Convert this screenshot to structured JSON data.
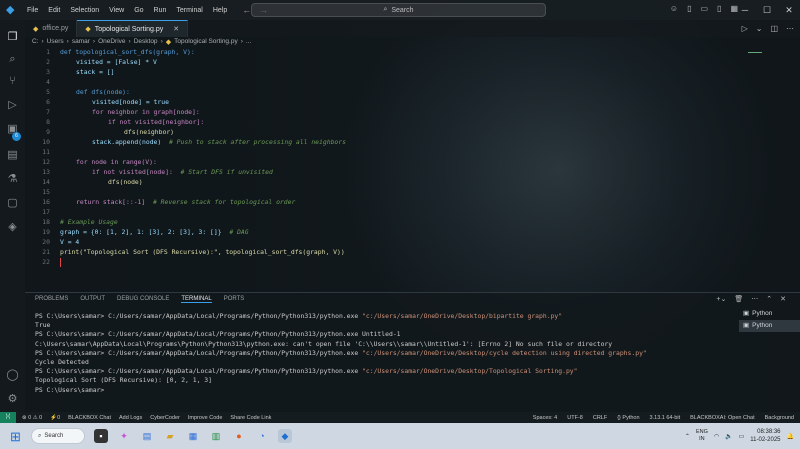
{
  "menu": [
    "File",
    "Edit",
    "Selection",
    "View",
    "Go",
    "Run",
    "Terminal",
    "Help"
  ],
  "search": {
    "label": "Search"
  },
  "tabs": [
    {
      "label": "office.py",
      "active": false
    },
    {
      "label": "Topological Sorting.py",
      "active": true
    }
  ],
  "breadcrumb": [
    "C:",
    "Users",
    "samar",
    "OneDrive",
    "Desktop",
    "Topological Sorting.py",
    "..."
  ],
  "code_lines": [
    {
      "n": "1"
    },
    {
      "n": "2"
    },
    {
      "n": "3"
    },
    {
      "n": "4"
    },
    {
      "n": "5"
    },
    {
      "n": "6"
    },
    {
      "n": "7"
    },
    {
      "n": "8"
    },
    {
      "n": "9"
    },
    {
      "n": "10"
    },
    {
      "n": "11"
    },
    {
      "n": "12"
    },
    {
      "n": "13"
    },
    {
      "n": "14"
    },
    {
      "n": "15"
    },
    {
      "n": "16"
    },
    {
      "n": "17"
    },
    {
      "n": "18"
    },
    {
      "n": "19"
    },
    {
      "n": "20"
    },
    {
      "n": "21"
    },
    {
      "n": "22"
    }
  ],
  "code": {
    "l1": "def topological_sort_dfs(graph, V):",
    "l2": "visited = [False] * V",
    "l3": "stack = []",
    "l5": "def dfs(node):",
    "l6": "visited[node] = true",
    "l7": "for neighbor in graph[node]:",
    "l8": "if not visited[neighbor]:",
    "l9": "dfs(neighbor)",
    "l10a": "stack.append(node)",
    "l10b": "# Push to stack after processing all neighbors",
    "l12": "for node in range(V):",
    "l13a": "if not visited[node]:",
    "l13b": "# Start DFS if unvisited",
    "l14": "dfs(node)",
    "l16a": "return stack[::-1]",
    "l16b": "# Reverse stack for topological order",
    "l18": "# Example Usage",
    "l19a": "graph = {0: [1, 2], 1: [3], 2: [3], 3: []}",
    "l19b": "# DAG",
    "l20": "V = 4",
    "l21": "print(\"Topological Sort (DFS Recursive):\", topological_sort_dfs(graph, V))"
  },
  "panel_tabs": [
    "PROBLEMS",
    "OUTPUT",
    "DEBUG CONSOLE",
    "TERMINAL",
    "PORTS"
  ],
  "terminal_lines": [
    {
      "prompt": "PS C:\\Users\\samar> ",
      "cmd": "C:/Users/samar/AppData/Local/Programs/Python/Python313/python.exe ",
      "str": "\"c:/Users/samar/OneDrive/Desktop/bipartite graph.py\""
    },
    {
      "prompt": "True",
      "cmd": "",
      "str": ""
    },
    {
      "prompt": "PS C:\\Users\\samar> ",
      "cmd": "C:/Users/samar/AppData/Local/Programs/Python/Python313/python.exe Untitled-1",
      "str": ""
    },
    {
      "prompt": "C:\\Users\\samar\\AppData\\Local\\Programs\\Python\\Python313\\python.exe: can't open file 'C:\\\\Users\\\\samar\\\\Untitled-1': [Errno 2] No such file or directory",
      "cmd": "",
      "str": ""
    },
    {
      "prompt": "PS C:\\Users\\samar> ",
      "cmd": "C:/Users/samar/AppData/Local/Programs/Python/Python313/python.exe ",
      "str": "\"c:/Users/samar/OneDrive/Desktop/cycle detection using directed graphs.py\""
    },
    {
      "prompt": "Cycle Detected",
      "cmd": "",
      "str": ""
    },
    {
      "prompt": "PS C:\\Users\\samar> ",
      "cmd": "C:/Users/samar/AppData/Local/Programs/Python/Python313/python.exe ",
      "str": "\"c:/Users/samar/OneDrive/Desktop/Topological Sorting.py\""
    },
    {
      "prompt": "Topological Sort (DFS Recursive): [0, 2, 1, 3]",
      "cmd": "",
      "str": ""
    },
    {
      "prompt": "PS C:\\Users\\samar> ",
      "cmd": "",
      "str": ""
    }
  ],
  "terminal_list": [
    "Python",
    "Python"
  ],
  "status": {
    "left": [
      "⊗ 0 ⚠ 0",
      "⚡0",
      "BLACKBOX Chat",
      "Add Logs",
      "CyberCoder",
      "Improve Code",
      "Share Code Link"
    ],
    "right": [
      "Spaces: 4",
      "UTF-8",
      "CRLF",
      "{} Python",
      "3.13.1 64-bit",
      "BLACKBOXAI: Open Chat",
      "Background"
    ]
  },
  "taskbar": {
    "search": "Search",
    "lang_top": "ENG",
    "lang_bottom": "IN",
    "time": "08:38:36",
    "date": "11-02-2025"
  },
  "colors": {
    "accent": "#3b9ee6",
    "remote": "#16825d"
  }
}
